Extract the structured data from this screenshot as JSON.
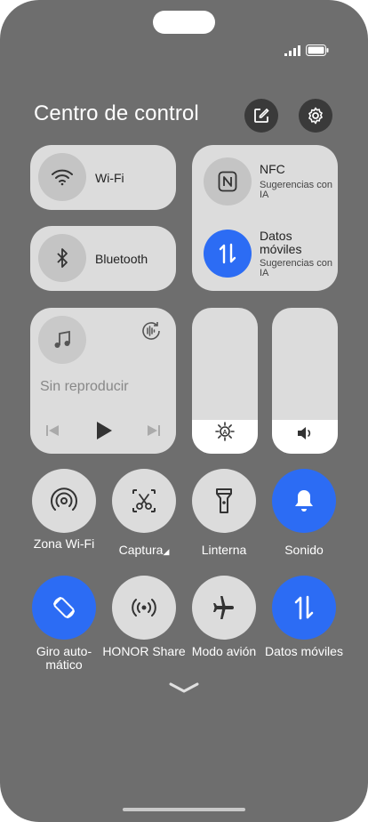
{
  "header": {
    "title": "Centro de control"
  },
  "connectivity": {
    "wifi": {
      "label": "Wi-Fi"
    },
    "bluetooth": {
      "label": "Bluetooth"
    },
    "nfc": {
      "label": "NFC",
      "sub": "Sugerencias con IA"
    },
    "mobile_data": {
      "label": "Datos móviles",
      "sub": "Sugerencias con IA"
    }
  },
  "media": {
    "status": "Sin reproducir"
  },
  "sliders": {
    "brightness_level": 0.23,
    "volume_level": 0.23
  },
  "quick_toggles": [
    {
      "label": "Zona Wi-Fi",
      "icon": "hotspot-icon",
      "active": false
    },
    {
      "label": "Captura",
      "icon": "screenshot-icon",
      "active": false
    },
    {
      "label": "Linterna",
      "icon": "flashlight-icon",
      "active": false
    },
    {
      "label": "Sonido",
      "icon": "bell-icon",
      "active": true
    },
    {
      "label": "Giro auto-mático",
      "icon": "auto-rotate-icon",
      "active": true
    },
    {
      "label": "HONOR Share",
      "icon": "share-icon",
      "active": false
    },
    {
      "label": "Modo avión",
      "icon": "airplane-icon",
      "active": false
    },
    {
      "label": "Datos móviles",
      "icon": "mobile-data-icon",
      "active": true
    }
  ],
  "colors": {
    "accent": "#2c6cf4",
    "background": "#6e6e6e",
    "tile": "#dcdcdc"
  }
}
